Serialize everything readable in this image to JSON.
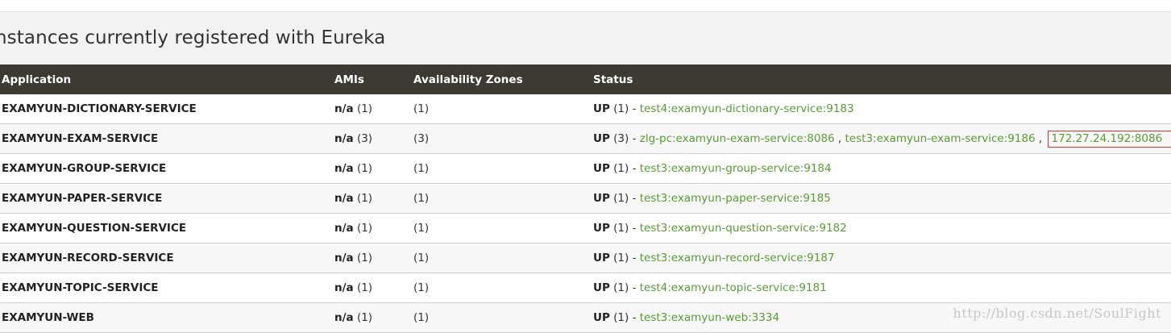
{
  "page": {
    "section_title": "nstances currently registered with Eureka",
    "watermark": "http://blog.csdn.net/SoulFight"
  },
  "table": {
    "headers": {
      "application": "Application",
      "amis": "AMIs",
      "zones": "Availability Zones",
      "status": "Status"
    },
    "rows": [
      {
        "application": "EXAMYUN-DICTIONARY-SERVICE",
        "ami_na": "n/a",
        "ami_count": " (1)",
        "zones": "(1)",
        "status_up": "UP",
        "status_count": " (1) - ",
        "instances": [
          "test4:examyun-dictionary-service:9183"
        ]
      },
      {
        "application": "EXAMYUN-EXAM-SERVICE",
        "ami_na": "n/a",
        "ami_count": " (3)",
        "zones": "(3)",
        "status_up": "UP",
        "status_count": " (3) - ",
        "instances": [
          "zlg-pc:examyun-exam-service:8086",
          "test3:examyun-exam-service:9186",
          "172.27.24.192:8086"
        ]
      },
      {
        "application": "EXAMYUN-GROUP-SERVICE",
        "ami_na": "n/a",
        "ami_count": " (1)",
        "zones": "(1)",
        "status_up": "UP",
        "status_count": " (1) - ",
        "instances": [
          "test3:examyun-group-service:9184"
        ]
      },
      {
        "application": "EXAMYUN-PAPER-SERVICE",
        "ami_na": "n/a",
        "ami_count": " (1)",
        "zones": "(1)",
        "status_up": "UP",
        "status_count": " (1) - ",
        "instances": [
          "test3:examyun-paper-service:9185"
        ]
      },
      {
        "application": "EXAMYUN-QUESTION-SERVICE",
        "ami_na": "n/a",
        "ami_count": " (1)",
        "zones": "(1)",
        "status_up": "UP",
        "status_count": " (1) - ",
        "instances": [
          "test3:examyun-question-service:9182"
        ]
      },
      {
        "application": "EXAMYUN-RECORD-SERVICE",
        "ami_na": "n/a",
        "ami_count": " (1)",
        "zones": "(1)",
        "status_up": "UP",
        "status_count": " (1) - ",
        "instances": [
          "test3:examyun-record-service:9187"
        ]
      },
      {
        "application": "EXAMYUN-TOPIC-SERVICE",
        "ami_na": "n/a",
        "ami_count": " (1)",
        "zones": "(1)",
        "status_up": "UP",
        "status_count": " (1) - ",
        "instances": [
          "test4:examyun-topic-service:9181"
        ]
      },
      {
        "application": "EXAMYUN-WEB",
        "ami_na": "n/a",
        "ami_count": " (1)",
        "zones": "(1)",
        "status_up": "UP",
        "status_count": " (1) - ",
        "instances": [
          "test3:examyun-web:3334"
        ]
      }
    ],
    "instance_separator": " , "
  },
  "colors": {
    "header_bg": "#3d3933",
    "link_green": "#5a9b36",
    "highlight_red": "#e03030"
  }
}
